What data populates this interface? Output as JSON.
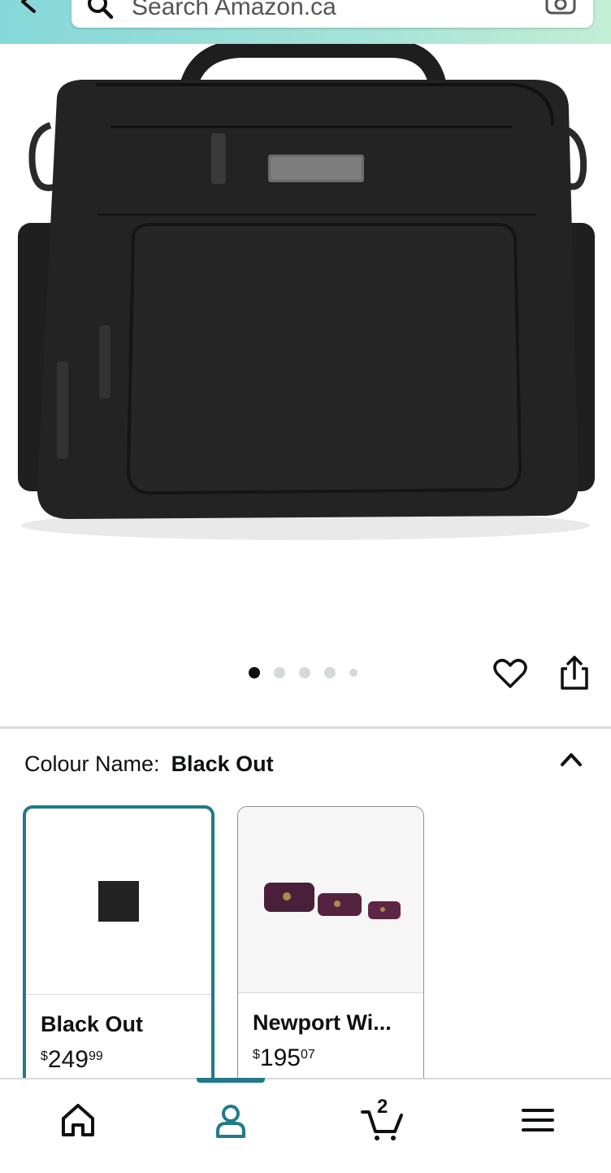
{
  "header": {
    "search_placeholder": "Search Amazon.ca"
  },
  "product": {
    "image_alt": "Black convertible diaper bag with jujube logo plate",
    "carousel": {
      "total": 5,
      "active_index": 0
    }
  },
  "colour": {
    "label": "Colour Name:",
    "selected_value": "Black Out",
    "options": [
      {
        "name": "Black Out",
        "price_symbol": "$",
        "price_whole": "249",
        "price_fraction": "99",
        "selected": true,
        "swatch_color": "#222222"
      },
      {
        "name": "Newport Wi...",
        "price_symbol": "$",
        "price_whole": "195",
        "price_fraction": "07",
        "selected": false
      }
    ]
  },
  "bottom_nav": {
    "items": [
      "home-icon",
      "account-icon",
      "cart-icon",
      "menu-icon"
    ],
    "active": "account-icon",
    "cart_count": "2"
  },
  "colors": {
    "accent": "#217a89",
    "header_gradient_start": "#85d7d9",
    "header_gradient_end": "#c3eed6"
  }
}
